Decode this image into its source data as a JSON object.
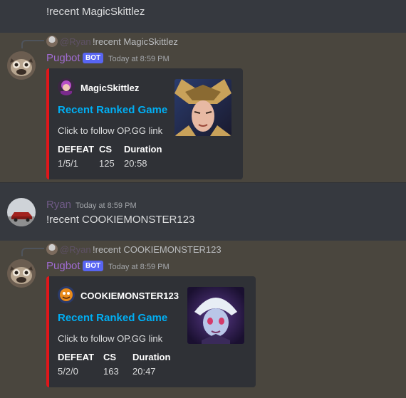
{
  "top_message": {
    "content": "!recent MagicSkittlez"
  },
  "message1": {
    "reply": {
      "name": "@Ryan",
      "text": "!recent MagicSkittlez"
    },
    "author": "Pugbot",
    "bot_tag": "BOT",
    "timestamp": "Today at 8:59 PM",
    "embed": {
      "author": "MagicSkittlez",
      "title": "Recent Ranked Game",
      "description": "Click to follow OP.GG link",
      "fields": [
        {
          "name": "DEFEAT",
          "value": "1/5/1"
        },
        {
          "name": "CS",
          "value": "125"
        },
        {
          "name": "Duration",
          "value": "20:58"
        }
      ],
      "color": "#e0161a"
    }
  },
  "message2": {
    "author": "Ryan",
    "timestamp": "Today at 8:59 PM",
    "content": "!recent COOKIEMONSTER123"
  },
  "message3": {
    "reply": {
      "name": "@Ryan",
      "text": "!recent COOKIEMONSTER123"
    },
    "author": "Pugbot",
    "bot_tag": "BOT",
    "timestamp": "Today at 8:59 PM",
    "embed": {
      "author": "COOKIEMONSTER123",
      "title": "Recent Ranked Game",
      "description": "Click to follow OP.GG link",
      "fields": [
        {
          "name": "DEFEAT",
          "value": "5/2/0"
        },
        {
          "name": "CS",
          "value": "163"
        },
        {
          "name": "Duration",
          "value": "20:47"
        }
      ],
      "color": "#e0161a"
    }
  },
  "colors": {
    "bot_tag": "#5865f2",
    "link": "#00aff4",
    "embed_bar": "#e0161a",
    "highlight": "#4a463e"
  }
}
